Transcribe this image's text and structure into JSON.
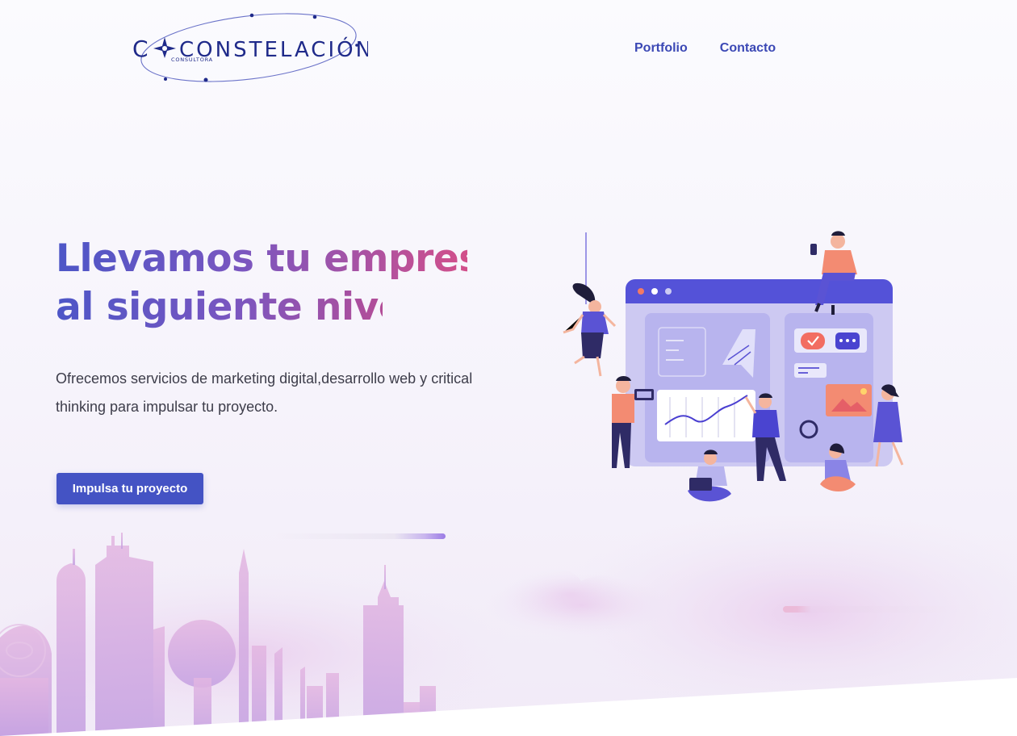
{
  "brand": {
    "name": "CONSTELACIÓN",
    "tagline": "CONSULTORA"
  },
  "nav": {
    "items": [
      {
        "label": "Portfolio"
      },
      {
        "label": "Contacto"
      }
    ]
  },
  "hero": {
    "title_line1": "Llevamos tu empresa",
    "title_line2": "al siguiente nivel",
    "description": "Ofrecemos servicios de marketing digital,desarrollo web y critical thinking para impulsar tu proyecto.",
    "cta_label": "Impulsa tu proyecto"
  },
  "colors": {
    "brand_navy": "#1f2a8a",
    "nav_blue": "#3b48b5",
    "button": "#4453c4",
    "title_gradient_start": "#4d56c7",
    "title_gradient_end": "#d24f8a",
    "illustration_purple": "#5b5bd6"
  }
}
